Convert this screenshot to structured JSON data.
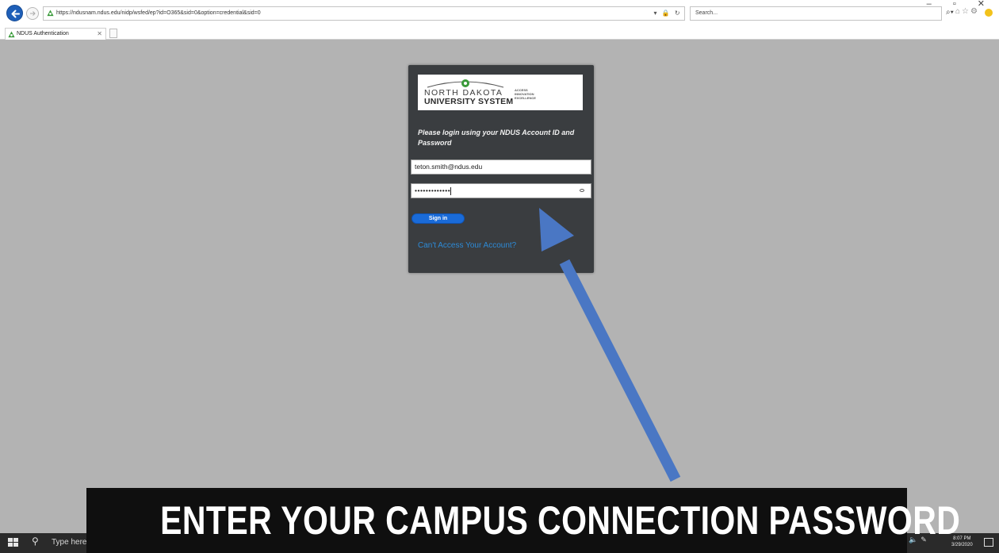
{
  "browser": {
    "url": "https://ndusnam.ndus.edu/nidp/wsfed/ep?id=O365&sid=0&option=credential&sid=0",
    "search_placeholder": "Search...",
    "tab_title": "NDUS Authentication"
  },
  "login": {
    "logo_line1": "NORTH DAKOTA",
    "logo_line2": "UNIVERSITY SYSTEM",
    "logo_tagline": [
      "ACCESS",
      "INNOVATION",
      "EXCELLENCE"
    ],
    "prompt": "Please login using your NDUS Account ID and Password",
    "username_value": "teton.smith@ndus.edu",
    "password_mask": "•••••••••••••",
    "signin_label": "Sign in",
    "help_link": "Can't Access Your Account?"
  },
  "taskbar": {
    "search_placeholder": "Type here",
    "time": "8:07 PM",
    "date": "3/29/2020"
  },
  "caption": {
    "text": "ENTER YOUR CAMPUS CONNECTION PASSWORD"
  },
  "colors": {
    "panel_bg": "#3a3d40",
    "accent_blue": "#1a6bd8",
    "arrow": "#4a77c4",
    "link": "#2d8ad6"
  }
}
